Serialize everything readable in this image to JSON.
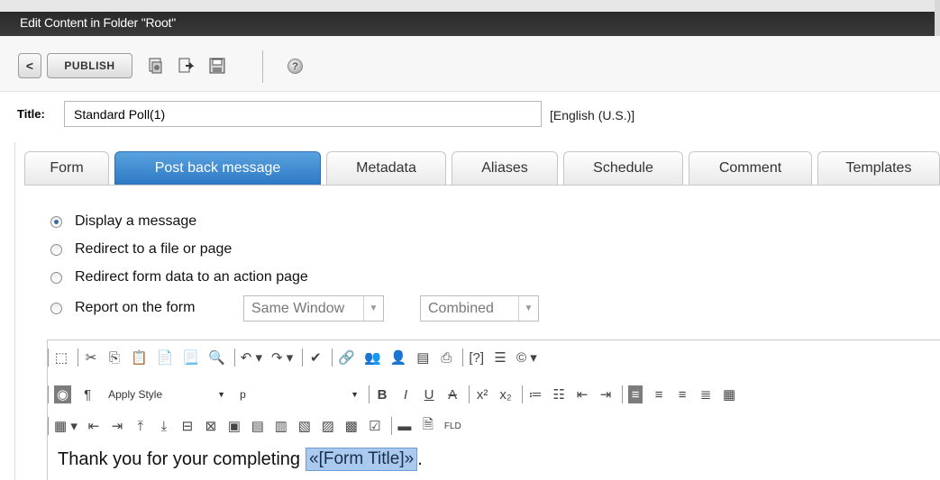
{
  "window": {
    "title": "Edit Content in Folder \"Root\""
  },
  "toolbar": {
    "back_label": "<",
    "publish_label": "PUBLISH",
    "icons": [
      "checkin-icon",
      "preview-icon",
      "save-icon",
      "help-icon"
    ]
  },
  "title_field": {
    "label": "Title:",
    "value": "Standard Poll(1)",
    "language": "[English (U.S.)]"
  },
  "tabs": [
    {
      "label": "Form",
      "active": false
    },
    {
      "label": "Post back message",
      "active": true
    },
    {
      "label": "Metadata",
      "active": false
    },
    {
      "label": "Aliases",
      "active": false
    },
    {
      "label": "Schedule",
      "active": false
    },
    {
      "label": "Comment",
      "active": false
    },
    {
      "label": "Templates",
      "active": false
    }
  ],
  "postback": {
    "options": [
      {
        "label": "Display a message",
        "checked": true
      },
      {
        "label": "Redirect to a file or page",
        "checked": false
      },
      {
        "label": "Redirect form data to an action page",
        "checked": false
      },
      {
        "label": "Report on the form",
        "checked": false
      }
    ],
    "window_select": "Same Window",
    "mode_select": "Combined"
  },
  "editor": {
    "style_dropdown": "Apply Style",
    "paragraph_dropdown": "p",
    "content_text": "Thank you for your completing",
    "field_token": "«[Form Title]»",
    "trailing": "."
  },
  "colors": {
    "active_tab": "#2c78c4",
    "titlebar": "#333333",
    "token_highlight": "#a9c9ee"
  }
}
